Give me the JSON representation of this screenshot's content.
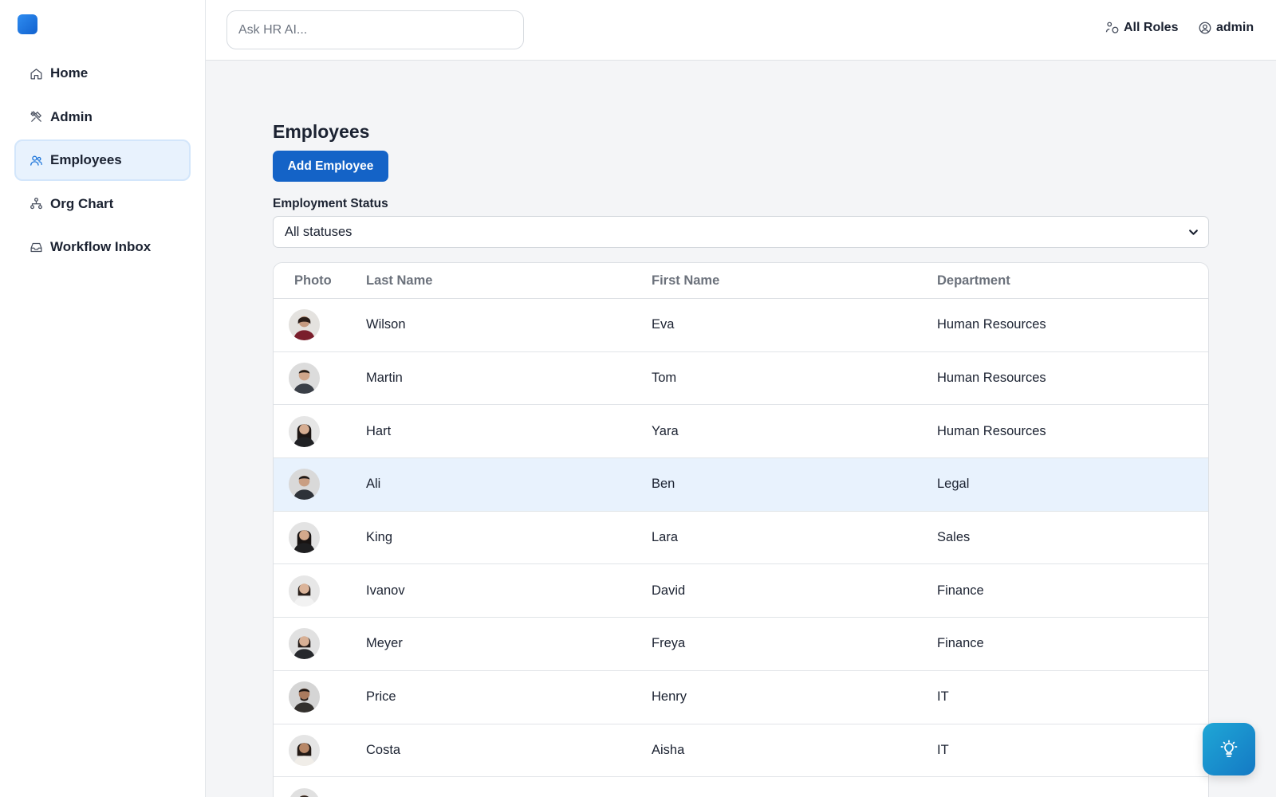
{
  "app": {
    "accent": "#1463c7",
    "logo_color": "#1e76e0"
  },
  "sidebar": {
    "items": [
      {
        "label": "Home",
        "icon": "home-icon",
        "active": false
      },
      {
        "label": "Admin",
        "icon": "tools-icon",
        "active": false
      },
      {
        "label": "Employees",
        "icon": "users-icon",
        "active": true
      },
      {
        "label": "Org Chart",
        "icon": "org-chart-icon",
        "active": false
      },
      {
        "label": "Workflow Inbox",
        "icon": "inbox-icon",
        "active": false
      }
    ]
  },
  "topbar": {
    "search_placeholder": "Ask HR AI...",
    "roles_label": "All Roles",
    "user_label": "admin"
  },
  "main": {
    "title": "Employees",
    "add_button": "Add Employee",
    "filter": {
      "label": "Employment Status",
      "selected": "All statuses"
    },
    "table": {
      "columns": [
        "Photo",
        "Last Name",
        "First Name",
        "Department"
      ],
      "rows": [
        {
          "last": "Wilson",
          "first": "Eva",
          "department": "Human Resources"
        },
        {
          "last": "Martin",
          "first": "Tom",
          "department": "Human Resources"
        },
        {
          "last": "Hart",
          "first": "Yara",
          "department": "Human Resources"
        },
        {
          "last": "Ali",
          "first": "Ben",
          "department": "Legal"
        },
        {
          "last": "King",
          "first": "Lara",
          "department": "Sales"
        },
        {
          "last": "Ivanov",
          "first": "David",
          "department": "Finance"
        },
        {
          "last": "Meyer",
          "first": "Freya",
          "department": "Finance"
        },
        {
          "last": "Price",
          "first": "Henry",
          "department": "IT"
        },
        {
          "last": "Costa",
          "first": "Aisha",
          "department": "IT"
        }
      ]
    }
  },
  "fab": {
    "icon": "lightbulb-icon",
    "color": "#1a93cf"
  }
}
